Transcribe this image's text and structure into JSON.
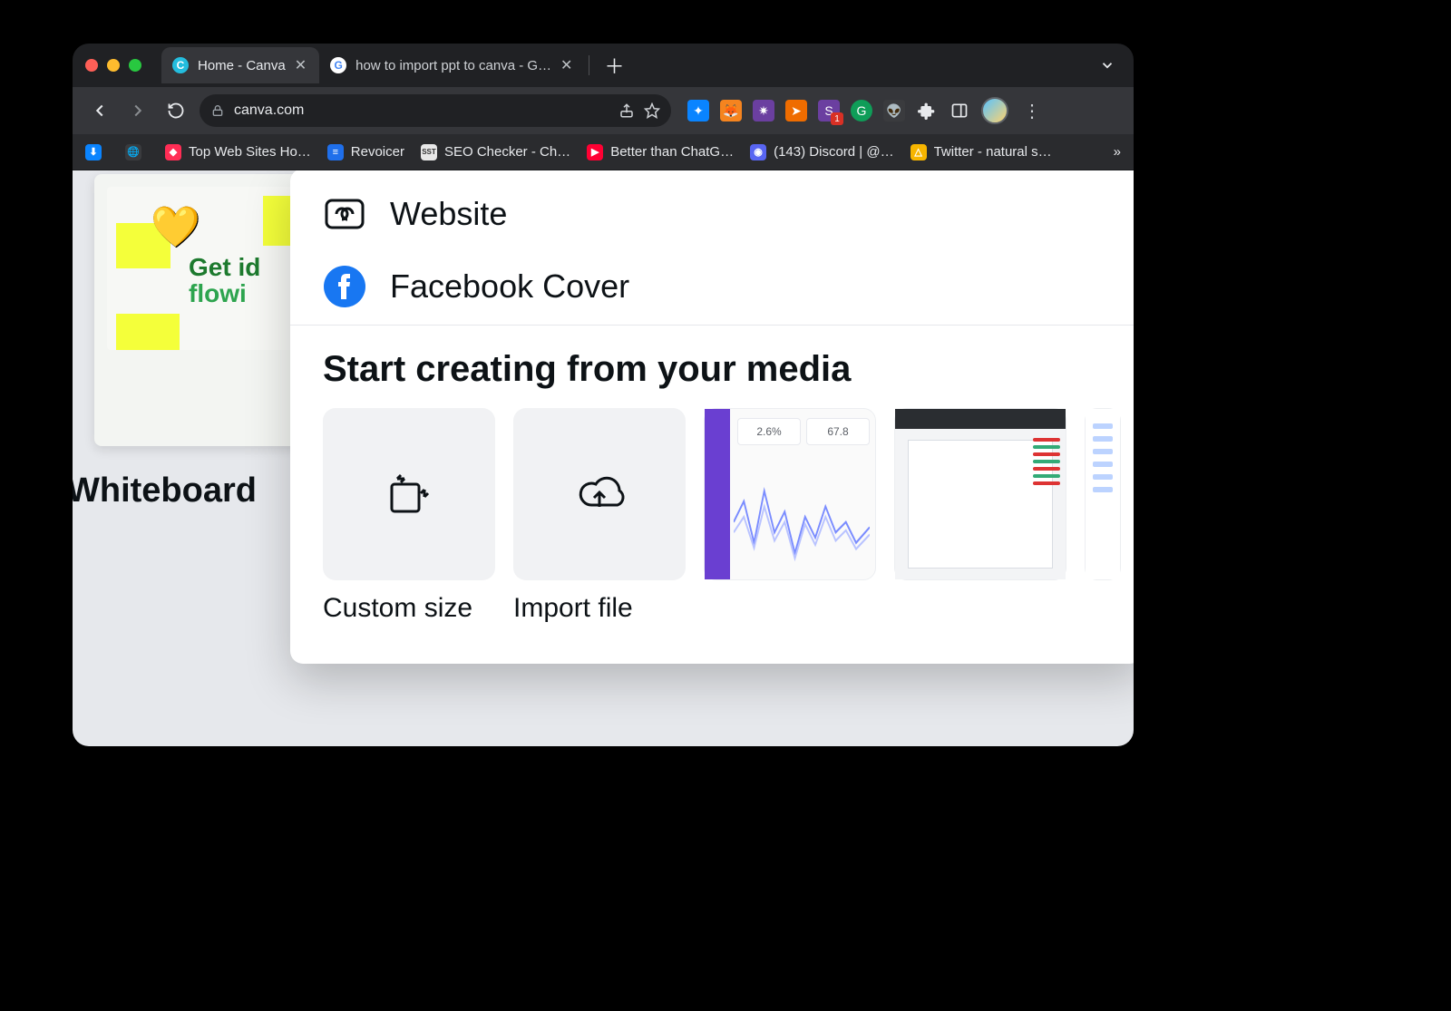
{
  "tabs": {
    "active": {
      "title": "Home - Canva",
      "favicon_bg": "#24bdde",
      "favicon_text": "C"
    },
    "second": {
      "title": "how to import ppt to canva - G…",
      "favicon_bg": "#ffffff",
      "favicon_text": "G"
    }
  },
  "toolbar": {
    "url": "canva.com"
  },
  "bookmarks": {
    "items": [
      {
        "label": "",
        "icon_bg": "#0a84ff",
        "icon_text": "⬇"
      },
      {
        "label": "",
        "icon_bg": "#3a3b3e",
        "icon_text": "🌐"
      },
      {
        "label": "Top Web Sites Ho…",
        "icon_bg": "#ff2d55",
        "icon_text": "◆"
      },
      {
        "label": "Revoicer",
        "icon_bg": "#1f6feb",
        "icon_text": "≡"
      },
      {
        "label": "SEO Checker - Ch…",
        "icon_bg": "#e8e8e8",
        "icon_text": "SST"
      },
      {
        "label": "Better than ChatG…",
        "icon_bg": "#ff0033",
        "icon_text": "▶"
      },
      {
        "label": "(143) Discord | @…",
        "icon_bg": "#5865f2",
        "icon_text": "◉"
      },
      {
        "label": "Twitter - natural s…",
        "icon_bg": "#f7b500",
        "icon_text": "△"
      }
    ]
  },
  "background": {
    "card_title_line1": "Get id",
    "card_title_line2": "flowi",
    "whiteboard_label": "Whiteboard"
  },
  "panel": {
    "options": [
      {
        "label": "Website",
        "icon": "link"
      },
      {
        "label": "Facebook Cover",
        "icon": "facebook"
      }
    ],
    "section_title": "Start creating from your media",
    "cards": [
      {
        "label": "Custom size",
        "kind": "custom"
      },
      {
        "label": "Import file",
        "kind": "import"
      }
    ],
    "analytics": {
      "metric1": "2.6%",
      "metric2": "67.8"
    }
  }
}
